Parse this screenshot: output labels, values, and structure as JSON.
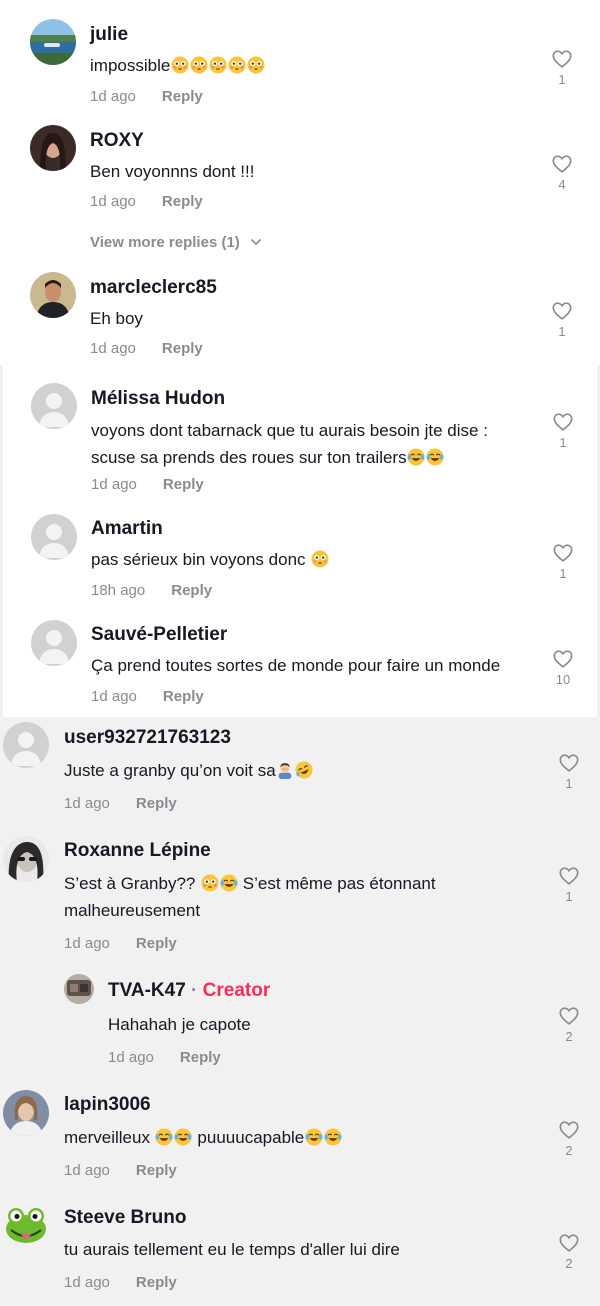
{
  "ui": {
    "reply_label": "Reply",
    "creator_label": "Creator",
    "creator_sep": " · "
  },
  "comments": [
    {
      "username": "julie",
      "text": "impossible",
      "time": "1d ago",
      "likes": "1"
    },
    {
      "username": "ROXY",
      "text": "Ben voyonnns dont !!!",
      "time": "1d ago",
      "likes": "4"
    },
    {
      "username": "marcleclerc85",
      "text": "Eh boy",
      "time": "1d ago",
      "likes": "1"
    },
    {
      "username": "Mélissa Hudon",
      "text_line1": "voyons dont tabarnack que tu aurais besoin jte dise :",
      "text_line2": "scuse sa prends des roues sur ton trailers",
      "time": "1d ago",
      "likes": "1"
    },
    {
      "username": "Amartin",
      "text": "pas sérieux bin voyons donc ",
      "time": "18h ago",
      "likes": "1"
    },
    {
      "username": "Sauvé-Pelletier",
      "text": "Ça prend toutes sortes de monde pour faire un monde",
      "time": "1d ago",
      "likes": "10"
    },
    {
      "username": "user932721763123",
      "text": "Juste a granby qu’on voit sa",
      "time": "1d ago",
      "likes": "1"
    },
    {
      "username": "Roxanne Lépine",
      "text_a": "S’est à Granby?? ",
      "text_b": " S’est même pas étonnant",
      "text_line2": "malheureusement",
      "time": "1d ago",
      "likes": "1"
    },
    {
      "username": "TVA-K47",
      "text": "Hahahah je capote",
      "time": "1d ago",
      "likes": "2"
    },
    {
      "username": "lapin3006",
      "text_a": "merveilleux ",
      "text_b": " puuuucapable",
      "time": "1d ago",
      "likes": "2"
    },
    {
      "username": "Steeve Bruno",
      "text": "tu aurais tellement eu le temps d'aller lui dire",
      "time": "1d ago",
      "likes": "2"
    }
  ],
  "view_more": "View more replies (1)",
  "colors": {
    "creator": "#fe2c55",
    "muted": "#8a8b91",
    "text": "#161823",
    "bg_grey": "#f1f1f2"
  },
  "icons": [
    "heart-outline-icon",
    "chevron-down-icon",
    "flushed-emoji-icon",
    "laughing-tears-emoji-icon",
    "rofl-emoji-icon",
    "man-facepalming-emoji-icon",
    "default-avatar-icon"
  ]
}
